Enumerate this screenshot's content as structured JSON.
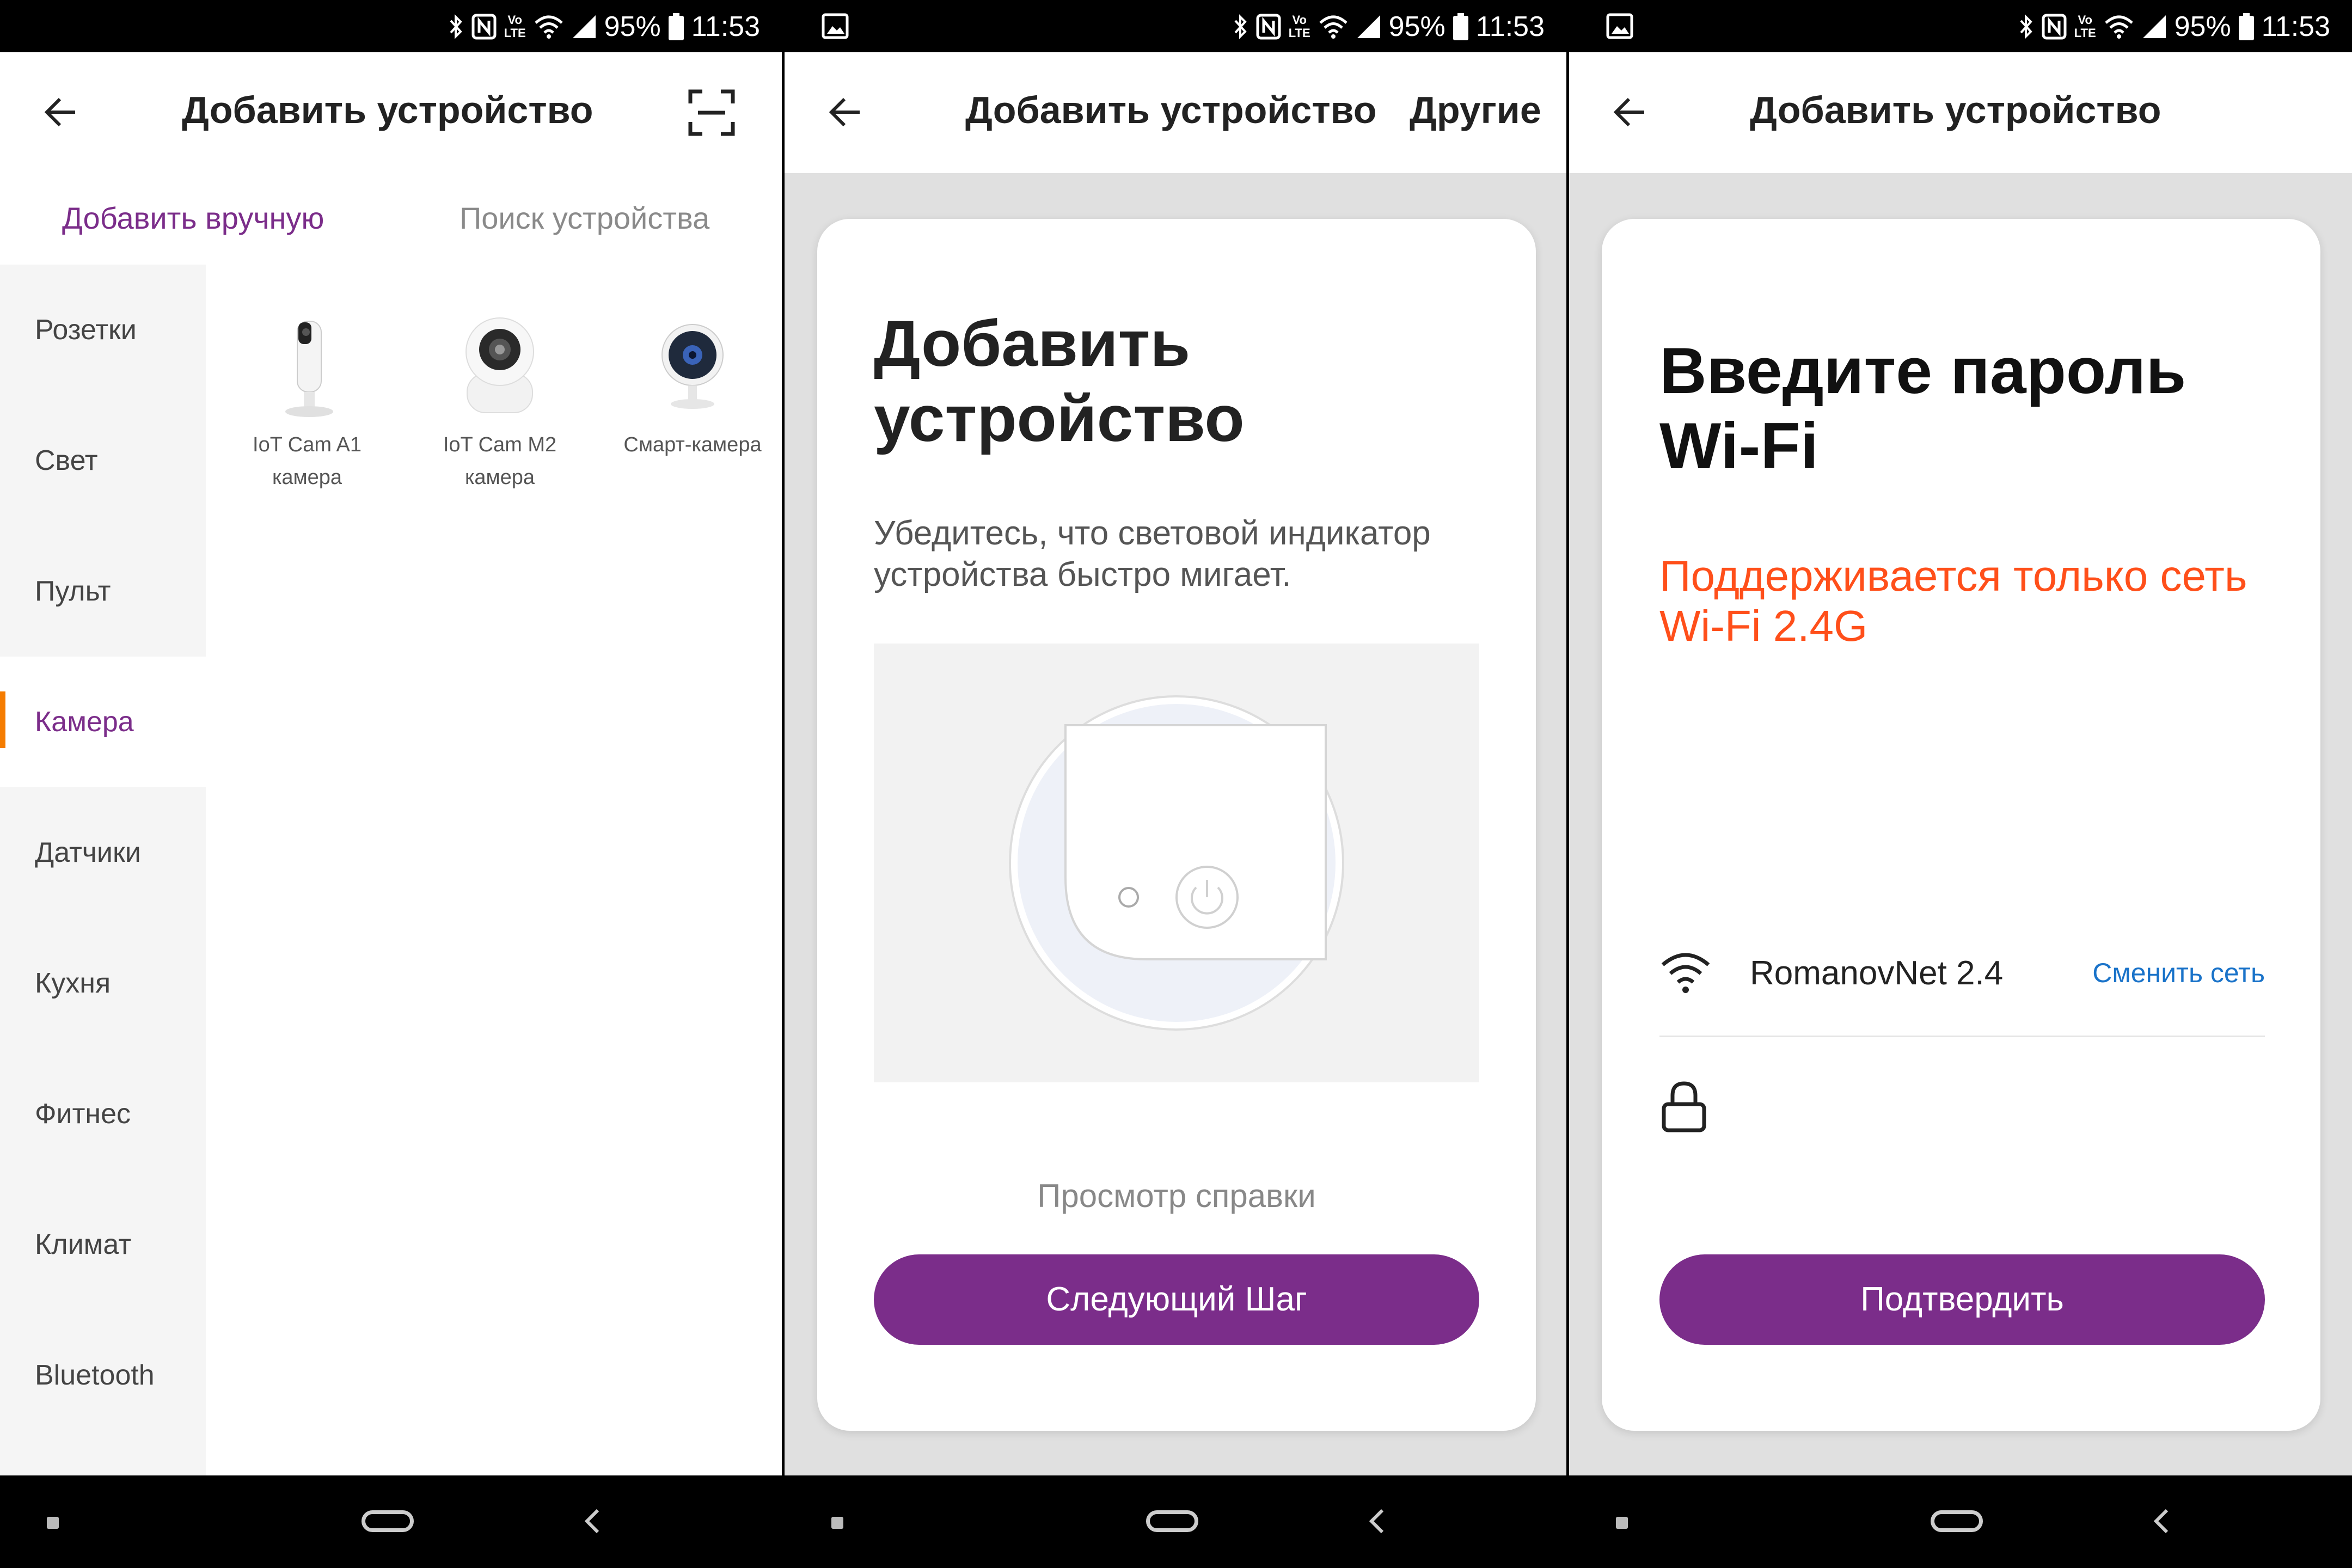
{
  "status_bar": {
    "battery": "95%",
    "time": "11:53"
  },
  "screen1": {
    "title": "Добавить устройство",
    "tabs": [
      "Добавить вручную",
      "Поиск устройства"
    ],
    "categories": [
      "Розетки",
      "Свет",
      "Пульт",
      "Камера",
      "Датчики",
      "Кухня",
      "Фитнес",
      "Климат",
      "Bluetooth"
    ],
    "selected_category": "Камера",
    "devices": [
      {
        "line1": "IoT Cam A1",
        "line2": "камера"
      },
      {
        "line1": "IoT Cam M2",
        "line2": "камера"
      },
      {
        "line1": "Смарт-камера",
        "line2": ""
      }
    ]
  },
  "screen2": {
    "title": "Добавить устройство",
    "action": "Другие",
    "heading_line1": "Добавить",
    "heading_line2": "устройство",
    "subtitle": "Убедитесь, что световой индикатор устройства быстро мигает.",
    "help_link": "Просмотр справки",
    "next_button": "Следующий Шаг"
  },
  "screen3": {
    "title": "Добавить устройство",
    "heading_line1": "Введите пароль",
    "heading_line2": "Wi-Fi",
    "warning_line1": "Поддерживается только сеть",
    "warning_line2": "Wi-Fi 2.4G",
    "ssid": "RomanovNet 2.4",
    "change_network": "Сменить сеть",
    "confirm_button": "Подтвердить"
  },
  "colors": {
    "accent": "#7b2d8a",
    "warning": "#ff4f1a",
    "link": "#1a73c9",
    "selection_bar": "#f57c00"
  }
}
